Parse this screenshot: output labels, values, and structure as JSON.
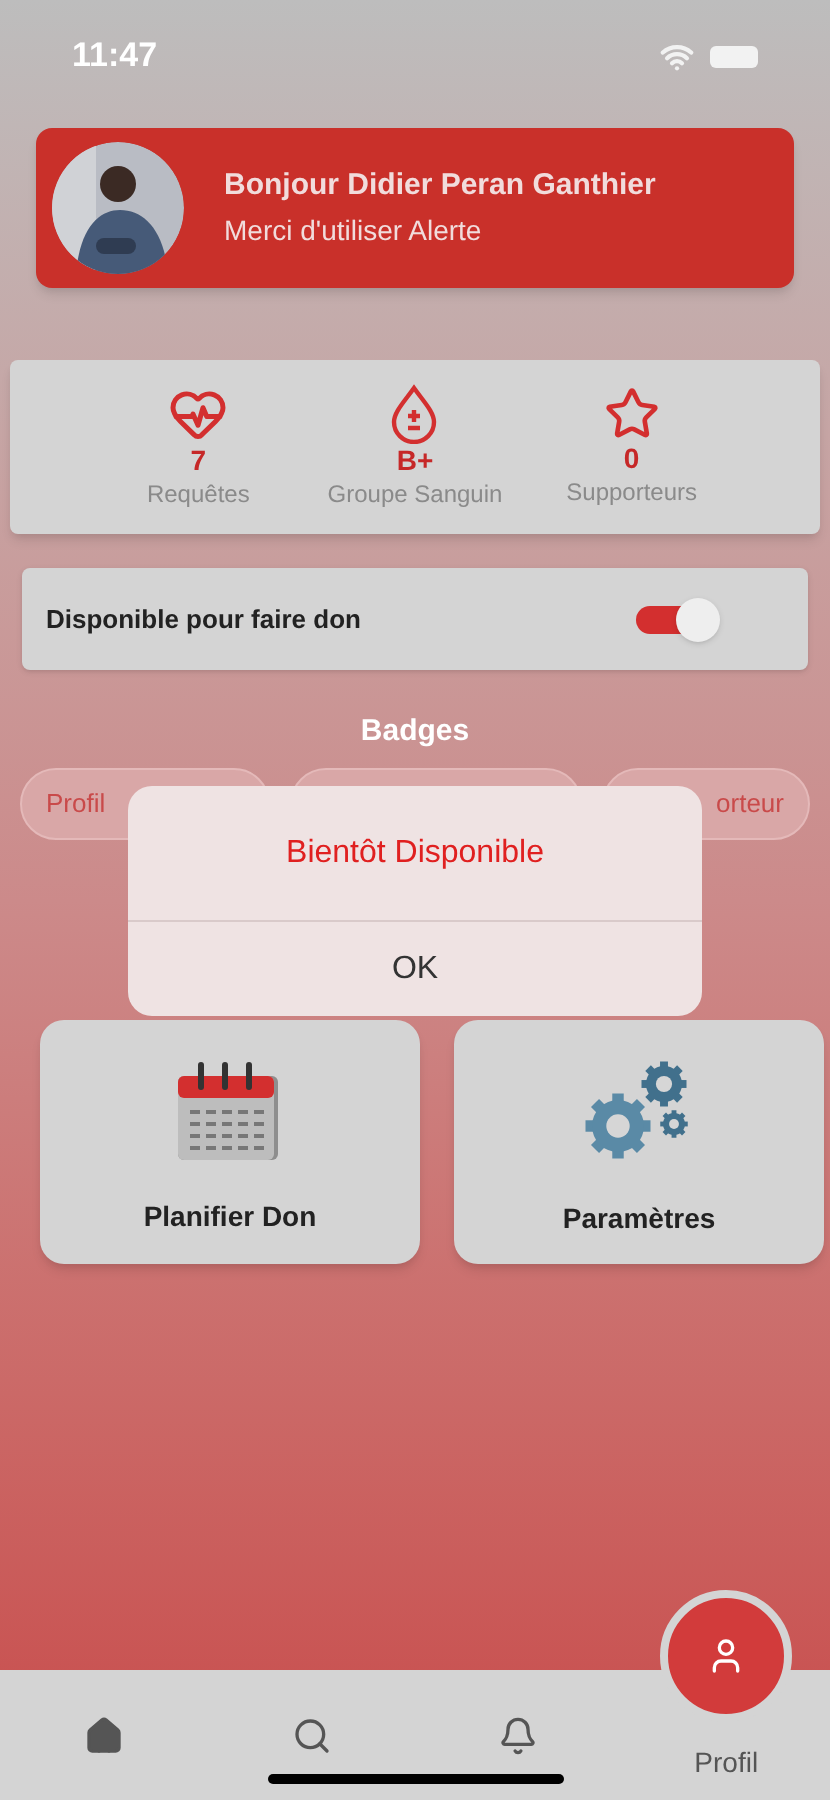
{
  "status_bar": {
    "time": "11:47"
  },
  "header": {
    "greeting": "Bonjour Didier Peran Ganthier",
    "subtitle": "Merci d'utiliser Alerte"
  },
  "stats": [
    {
      "kind": "heart",
      "value": "7",
      "label": "Requêtes"
    },
    {
      "kind": "drop",
      "value": "B+",
      "label": "Groupe Sanguin"
    },
    {
      "kind": "star",
      "value": "0",
      "label": "Supporteurs"
    }
  ],
  "availability": {
    "label": "Disponible pour faire don",
    "on": true
  },
  "badges_title": "Badges",
  "badges": [
    {
      "kind": "labeled",
      "text": "Profil"
    },
    {
      "kind": "covered"
    },
    {
      "kind": "labeled",
      "text": "orteur"
    }
  ],
  "dialog": {
    "title": "Bientôt Disponible",
    "button": "OK"
  },
  "tiles": [
    {
      "kind": "calendar",
      "label": "Planifier Don"
    },
    {
      "kind": "gears",
      "label": "Paramètres"
    }
  ],
  "nav": [
    {
      "kind": "home",
      "selected": false
    },
    {
      "kind": "search",
      "selected": false
    },
    {
      "kind": "bell",
      "selected": false
    },
    {
      "kind": "profile",
      "selected": true,
      "label": "Profil"
    }
  ]
}
